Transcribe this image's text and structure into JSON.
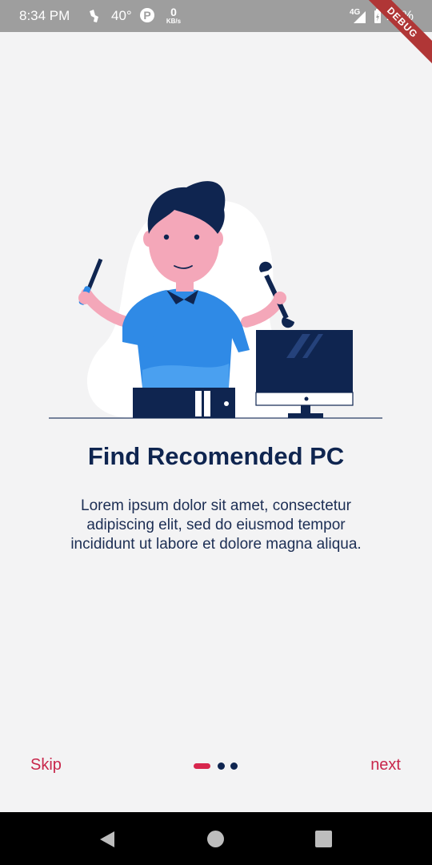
{
  "status_bar": {
    "time": "8:34 PM",
    "temperature": "40°",
    "parking_icon_label": "P",
    "data_speed_value": "0",
    "data_speed_unit": "KB/s",
    "network_type": "4G",
    "battery_percent": "27%",
    "debug_banner": "DEBUG"
  },
  "onboarding": {
    "title": "Find Recomended PC",
    "description": "Lorem ipsum dolor sit amet, consectetur adipiscing elit, sed do eiusmod tempor incididunt ut labore et dolore magna aliqua.",
    "skip_label": "Skip",
    "next_label": "next",
    "page_indicator": {
      "current_page": 1,
      "total_pages": 3
    }
  },
  "colors": {
    "accent": "#d7264d",
    "navy": "#0f2550",
    "shirt_blue": "#2f8ae6",
    "skin": "#f4a7b9",
    "background": "#f3f3f4"
  },
  "icons": [
    "signal-icon",
    "hiking-icon",
    "parking-icon",
    "charging-icon",
    "back-icon",
    "home-icon",
    "recents-icon"
  ]
}
